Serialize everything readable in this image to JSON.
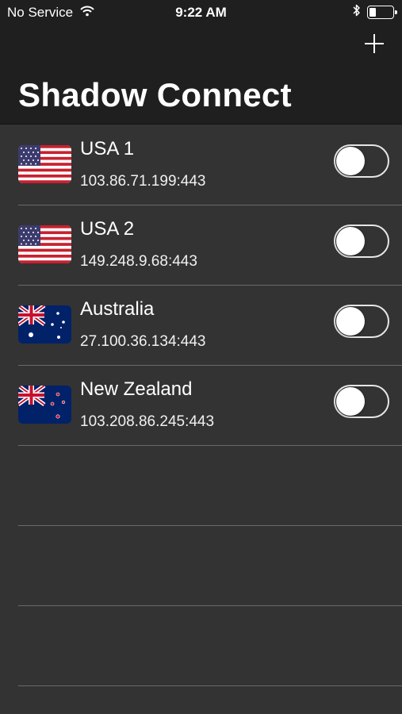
{
  "status_bar": {
    "carrier": "No Service",
    "time": "9:22 AM",
    "battery_level": 0.3,
    "icons": [
      "wifi-icon",
      "bluetooth-icon",
      "battery-icon"
    ]
  },
  "header": {
    "title": "Shadow Connect",
    "add_icon": "plus-icon"
  },
  "servers": [
    {
      "name": "USA 1",
      "address": "103.86.71.199:443",
      "flag": "usa-flag",
      "connected": false
    },
    {
      "name": "USA 2",
      "address": "149.248.9.68:443",
      "flag": "usa-flag",
      "connected": false
    },
    {
      "name": "Australia",
      "address": "27.100.36.134:443",
      "flag": "australia-flag",
      "connected": false
    },
    {
      "name": "New Zealand",
      "address": "103.208.86.245:443",
      "flag": "new-zealand-flag",
      "connected": false
    }
  ],
  "colors": {
    "background": "#333333",
    "header_background": "#1f1f1f",
    "separator": "#6a6a6a",
    "text": "#ffffff"
  }
}
